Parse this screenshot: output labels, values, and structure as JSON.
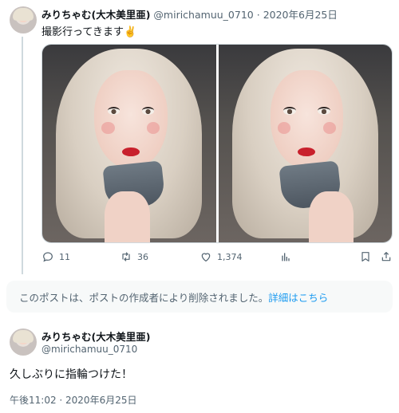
{
  "tweet1": {
    "display_name": "みりちゃむ(大木美里亜)",
    "handle": "@mirichamuu_0710",
    "separator": "·",
    "date": "2020年6月25日",
    "text": "撮影行ってきます✌️",
    "stats": {
      "replies": "11",
      "retweets": "36",
      "likes": "1,374"
    }
  },
  "deleted_notice": {
    "message": "このポストは、ポストの作成者により削除されました。",
    "link": "詳細はこちら"
  },
  "tweet2": {
    "display_name": "みりちゃむ(大木美里亜)",
    "handle": "@mirichamuu_0710",
    "text": "久しぶりに指輪つけた！",
    "timestamp": "午後11:02 · 2020年6月25日"
  },
  "icons": [
    "reply-icon",
    "retweet-icon",
    "like-icon",
    "views-icon",
    "bookmark-icon",
    "share-icon"
  ],
  "colors": {
    "link": "#1d9bf0",
    "muted": "#536471",
    "text": "#0f1419"
  }
}
